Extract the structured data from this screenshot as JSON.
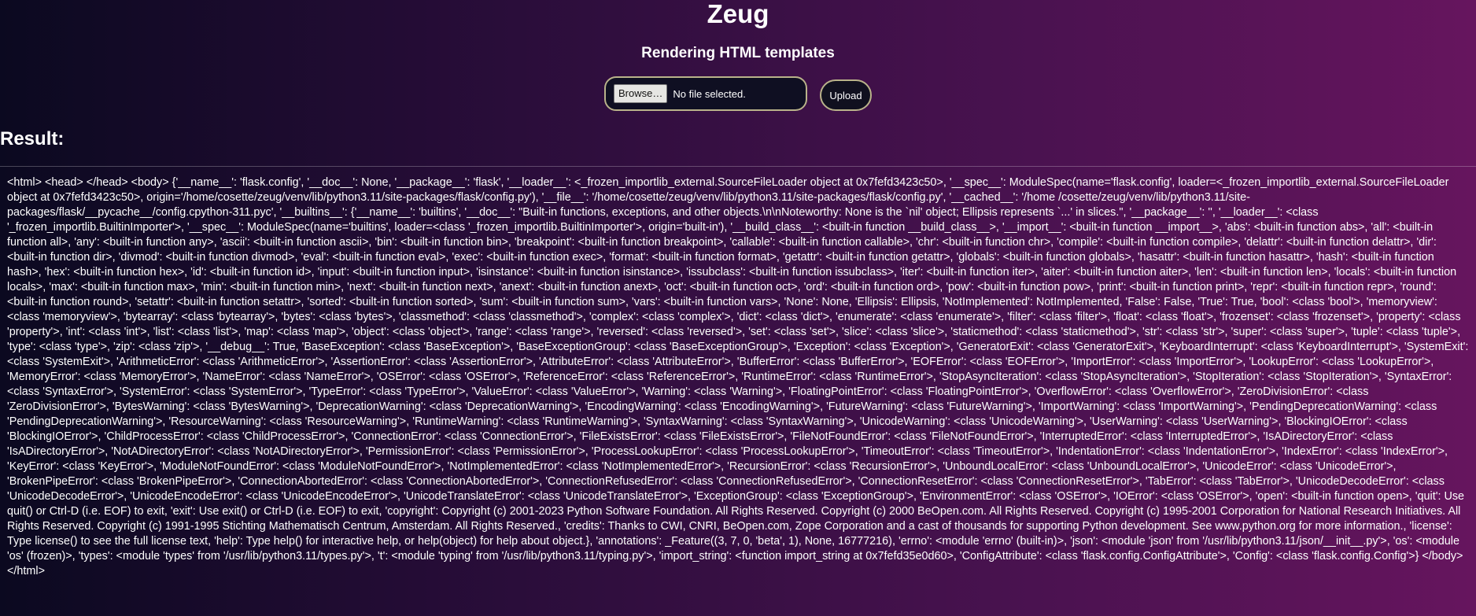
{
  "header": {
    "title": "Zeug",
    "subtitle": "Rendering HTML templates"
  },
  "upload_form": {
    "browse_label": "Browse…",
    "file_status": "No file selected.",
    "upload_label": "Upload"
  },
  "result": {
    "heading": "Result:",
    "output": "<html> <head> </head> <body> {'__name__': 'flask.config', '__doc__': None, '__package__': 'flask', '__loader__': <_frozen_importlib_external.SourceFileLoader object at 0x7fefd3423c50>, '__spec__': ModuleSpec(name='flask.config', loader=<_frozen_importlib_external.SourceFileLoader object at 0x7fefd3423c50>, origin='/home/cosette/zeug/venv/lib/python3.11/site-packages/flask/config.py'), '__file__': '/home/cosette/zeug/venv/lib/python3.11/site-packages/flask/config.py', '__cached__': '/home /cosette/zeug/venv/lib/python3.11/site-packages/flask/__pycache__/config.cpython-311.pyc', '__builtins__': {'__name__': 'builtins', '__doc__': \"Built-in functions, exceptions, and other objects.\\n\\nNoteworthy: None is the `nil' object; Ellipsis represents `...' in slices.\", '__package__': '', '__loader__': <class '_frozen_importlib.BuiltinImporter'>, '__spec__': ModuleSpec(name='builtins', loader=<class '_frozen_importlib.BuiltinImporter'>, origin='built-in'), '__build_class__': <built-in function __build_class__>, '__import__': <built-in function __import__>, 'abs': <built-in function abs>, 'all': <built-in function all>, 'any': <built-in function any>, 'ascii': <built-in function ascii>, 'bin': <built-in function bin>, 'breakpoint': <built-in function breakpoint>, 'callable': <built-in function callable>, 'chr': <built-in function chr>, 'compile': <built-in function compile>, 'delattr': <built-in function delattr>, 'dir': <built-in function dir>, 'divmod': <built-in function divmod>, 'eval': <built-in function eval>, 'exec': <built-in function exec>, 'format': <built-in function format>, 'getattr': <built-in function getattr>, 'globals': <built-in function globals>, 'hasattr': <built-in function hasattr>, 'hash': <built-in function hash>, 'hex': <built-in function hex>, 'id': <built-in function id>, 'input': <built-in function input>, 'isinstance': <built-in function isinstance>, 'issubclass': <built-in function issubclass>, 'iter': <built-in function iter>, 'aiter': <built-in function aiter>, 'len': <built-in function len>, 'locals': <built-in function locals>, 'max': <built-in function max>, 'min': <built-in function min>, 'next': <built-in function next>, 'anext': <built-in function anext>, 'oct': <built-in function oct>, 'ord': <built-in function ord>, 'pow': <built-in function pow>, 'print': <built-in function print>, 'repr': <built-in function repr>, 'round': <built-in function round>, 'setattr': <built-in function setattr>, 'sorted': <built-in function sorted>, 'sum': <built-in function sum>, 'vars': <built-in function vars>, 'None': None, 'Ellipsis': Ellipsis, 'NotImplemented': NotImplemented, 'False': False, 'True': True, 'bool': <class 'bool'>, 'memoryview': <class 'memoryview'>, 'bytearray': <class 'bytearray'>, 'bytes': <class 'bytes'>, 'classmethod': <class 'classmethod'>, 'complex': <class 'complex'>, 'dict': <class 'dict'>, 'enumerate': <class 'enumerate'>, 'filter': <class 'filter'>, 'float': <class 'float'>, 'frozenset': <class 'frozenset'>, 'property': <class 'property'>, 'int': <class 'int'>, 'list': <class 'list'>, 'map': <class 'map'>, 'object': <class 'object'>, 'range': <class 'range'>, 'reversed': <class 'reversed'>, 'set': <class 'set'>, 'slice': <class 'slice'>, 'staticmethod': <class 'staticmethod'>, 'str': <class 'str'>, 'super': <class 'super'>, 'tuple': <class 'tuple'>, 'type': <class 'type'>, 'zip': <class 'zip'>, '__debug__': True, 'BaseException': <class 'BaseException'>, 'BaseExceptionGroup': <class 'BaseExceptionGroup'>, 'Exception': <class 'Exception'>, 'GeneratorExit': <class 'GeneratorExit'>, 'KeyboardInterrupt': <class 'KeyboardInterrupt'>, 'SystemExit': <class 'SystemExit'>, 'ArithmeticError': <class 'ArithmeticError'>, 'AssertionError': <class 'AssertionError'>, 'AttributeError': <class 'AttributeError'>, 'BufferError': <class 'BufferError'>, 'EOFError': <class 'EOFError'>, 'ImportError': <class 'ImportError'>, 'LookupError': <class 'LookupError'>, 'MemoryError': <class 'MemoryError'>, 'NameError': <class 'NameError'>, 'OSError': <class 'OSError'>, 'ReferenceError': <class 'ReferenceError'>, 'RuntimeError': <class 'RuntimeError'>, 'StopAsyncIteration': <class 'StopAsyncIteration'>, 'StopIteration': <class 'StopIteration'>, 'SyntaxError': <class 'SyntaxError'>, 'SystemError': <class 'SystemError'>, 'TypeError': <class 'TypeError'>, 'ValueError': <class 'ValueError'>, 'Warning': <class 'Warning'>, 'FloatingPointError': <class 'FloatingPointError'>, 'OverflowError': <class 'OverflowError'>, 'ZeroDivisionError': <class 'ZeroDivisionError'>, 'BytesWarning': <class 'BytesWarning'>, 'DeprecationWarning': <class 'DeprecationWarning'>, 'EncodingWarning': <class 'EncodingWarning'>, 'FutureWarning': <class 'FutureWarning'>, 'ImportWarning': <class 'ImportWarning'>, 'PendingDeprecationWarning': <class 'PendingDeprecationWarning'>, 'ResourceWarning': <class 'ResourceWarning'>, 'RuntimeWarning': <class 'RuntimeWarning'>, 'SyntaxWarning': <class 'SyntaxWarning'>, 'UnicodeWarning': <class 'UnicodeWarning'>, 'UserWarning': <class 'UserWarning'>, 'BlockingIOError': <class 'BlockingIOError'>, 'ChildProcessError': <class 'ChildProcessError'>, 'ConnectionError': <class 'ConnectionError'>, 'FileExistsError': <class 'FileExistsError'>, 'FileNotFoundError': <class 'FileNotFoundError'>, 'InterruptedError': <class 'InterruptedError'>, 'IsADirectoryError': <class 'IsADirectoryError'>, 'NotADirectoryError': <class 'NotADirectoryError'>, 'PermissionError': <class 'PermissionError'>, 'ProcessLookupError': <class 'ProcessLookupError'>, 'TimeoutError': <class 'TimeoutError'>, 'IndentationError': <class 'IndentationError'>, 'IndexError': <class 'IndexError'>, 'KeyError': <class 'KeyError'>, 'ModuleNotFoundError': <class 'ModuleNotFoundError'>, 'NotImplementedError': <class 'NotImplementedError'>, 'RecursionError': <class 'RecursionError'>, 'UnboundLocalError': <class 'UnboundLocalError'>, 'UnicodeError': <class 'UnicodeError'>, 'BrokenPipeError': <class 'BrokenPipeError'>, 'ConnectionAbortedError': <class 'ConnectionAbortedError'>, 'ConnectionRefusedError': <class 'ConnectionRefusedError'>, 'ConnectionResetError': <class 'ConnectionResetError'>, 'TabError': <class 'TabError'>, 'UnicodeDecodeError': <class 'UnicodeDecodeError'>, 'UnicodeEncodeError': <class 'UnicodeEncodeError'>, 'UnicodeTranslateError': <class 'UnicodeTranslateError'>, 'ExceptionGroup': <class 'ExceptionGroup'>, 'EnvironmentError': <class 'OSError'>, 'IOError': <class 'OSError'>, 'open': <built-in function open>, 'quit': Use quit() or Ctrl-D (i.e. EOF) to exit, 'exit': Use exit() or Ctrl-D (i.e. EOF) to exit, 'copyright': Copyright (c) 2001-2023 Python Software Foundation. All Rights Reserved. Copyright (c) 2000 BeOpen.com. All Rights Reserved. Copyright (c) 1995-2001 Corporation for National Research Initiatives. All Rights Reserved. Copyright (c) 1991-1995 Stichting Mathematisch Centrum, Amsterdam. All Rights Reserved., 'credits': Thanks to CWI, CNRI, BeOpen.com, Zope Corporation and a cast of thousands for supporting Python development. See www.python.org for more information., 'license': Type license() to see the full license text, 'help': Type help() for interactive help, or help(object) for help about object.}, 'annotations': _Feature((3, 7, 0, 'beta', 1), None, 16777216), 'errno': <module 'errno' (built-in)>, 'json': <module 'json' from '/usr/lib/python3.11/json/__init__.py'>, 'os': <module 'os' (frozen)>, 'types': <module 'types' from '/usr/lib/python3.11/types.py'>, 't': <module 'typing' from '/usr/lib/python3.11/typing.py'>, 'import_string': <function import_string at 0x7fefd35e0d60>, 'ConfigAttribute': <class 'flask.config.ConfigAttribute'>, 'Config': <class 'flask.config.Config'>} </body> </html>"
  },
  "colors": {
    "background_left": "#0b0920",
    "background_right": "#66155e",
    "accent_border": "#b9b28a",
    "text": "#ffffff"
  }
}
